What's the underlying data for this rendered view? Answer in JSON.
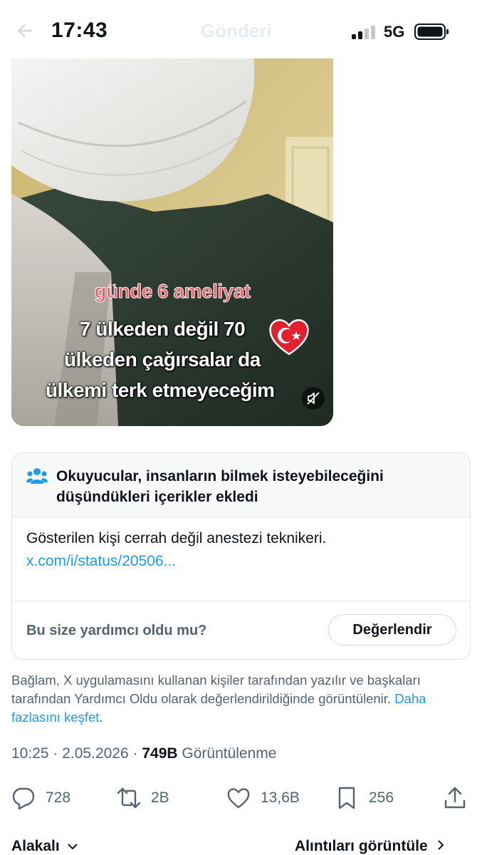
{
  "status_bar": {
    "time": "17:43",
    "title": "Gönderi",
    "network": "5G"
  },
  "video": {
    "caption_red": "günde 6 ameliyat",
    "caption_lines": [
      "7 ülkeden değil 70",
      "ülkeden çağırsalar da",
      "ülkemi terk etmeyeceğim"
    ],
    "mute_icon": "speaker-muted-icon"
  },
  "community_note": {
    "title": "Okuyucular, insanların bilmek isteyebileceğini düşündükleri içerikler ekledi",
    "body": "Gösterilen kişi cerrah değil anestezi teknikeri.",
    "link": "x.com/i/status/20506...",
    "helpful_question": "Bu size yardımcı oldu mu?",
    "rate_button": "Değerlendir"
  },
  "context_note": {
    "text": "Bağlam, X uygulamasını kullanan kişiler tarafından yazılır ve başkaları tarafından Yardımcı Oldu olarak değerlendirildiğinde görüntülenir.",
    "explore_link": "Daha fazlasını keşfet",
    "end": "."
  },
  "post_meta": {
    "time": "10:25",
    "sep1": " · ",
    "date": "2.05.2026",
    "sep2": " · ",
    "views": "749B",
    "views_label": " Görüntülenme"
  },
  "actions": {
    "replies": "728",
    "reposts": "2B",
    "likes": "13,6B",
    "bookmarks": "256"
  },
  "bottom": {
    "related": "Alakalı",
    "quotes": "Alıntıları görüntüle"
  },
  "colors": {
    "accent": "#1d9bf0",
    "secondary_text": "#536471",
    "primary_text": "#0f1419"
  }
}
